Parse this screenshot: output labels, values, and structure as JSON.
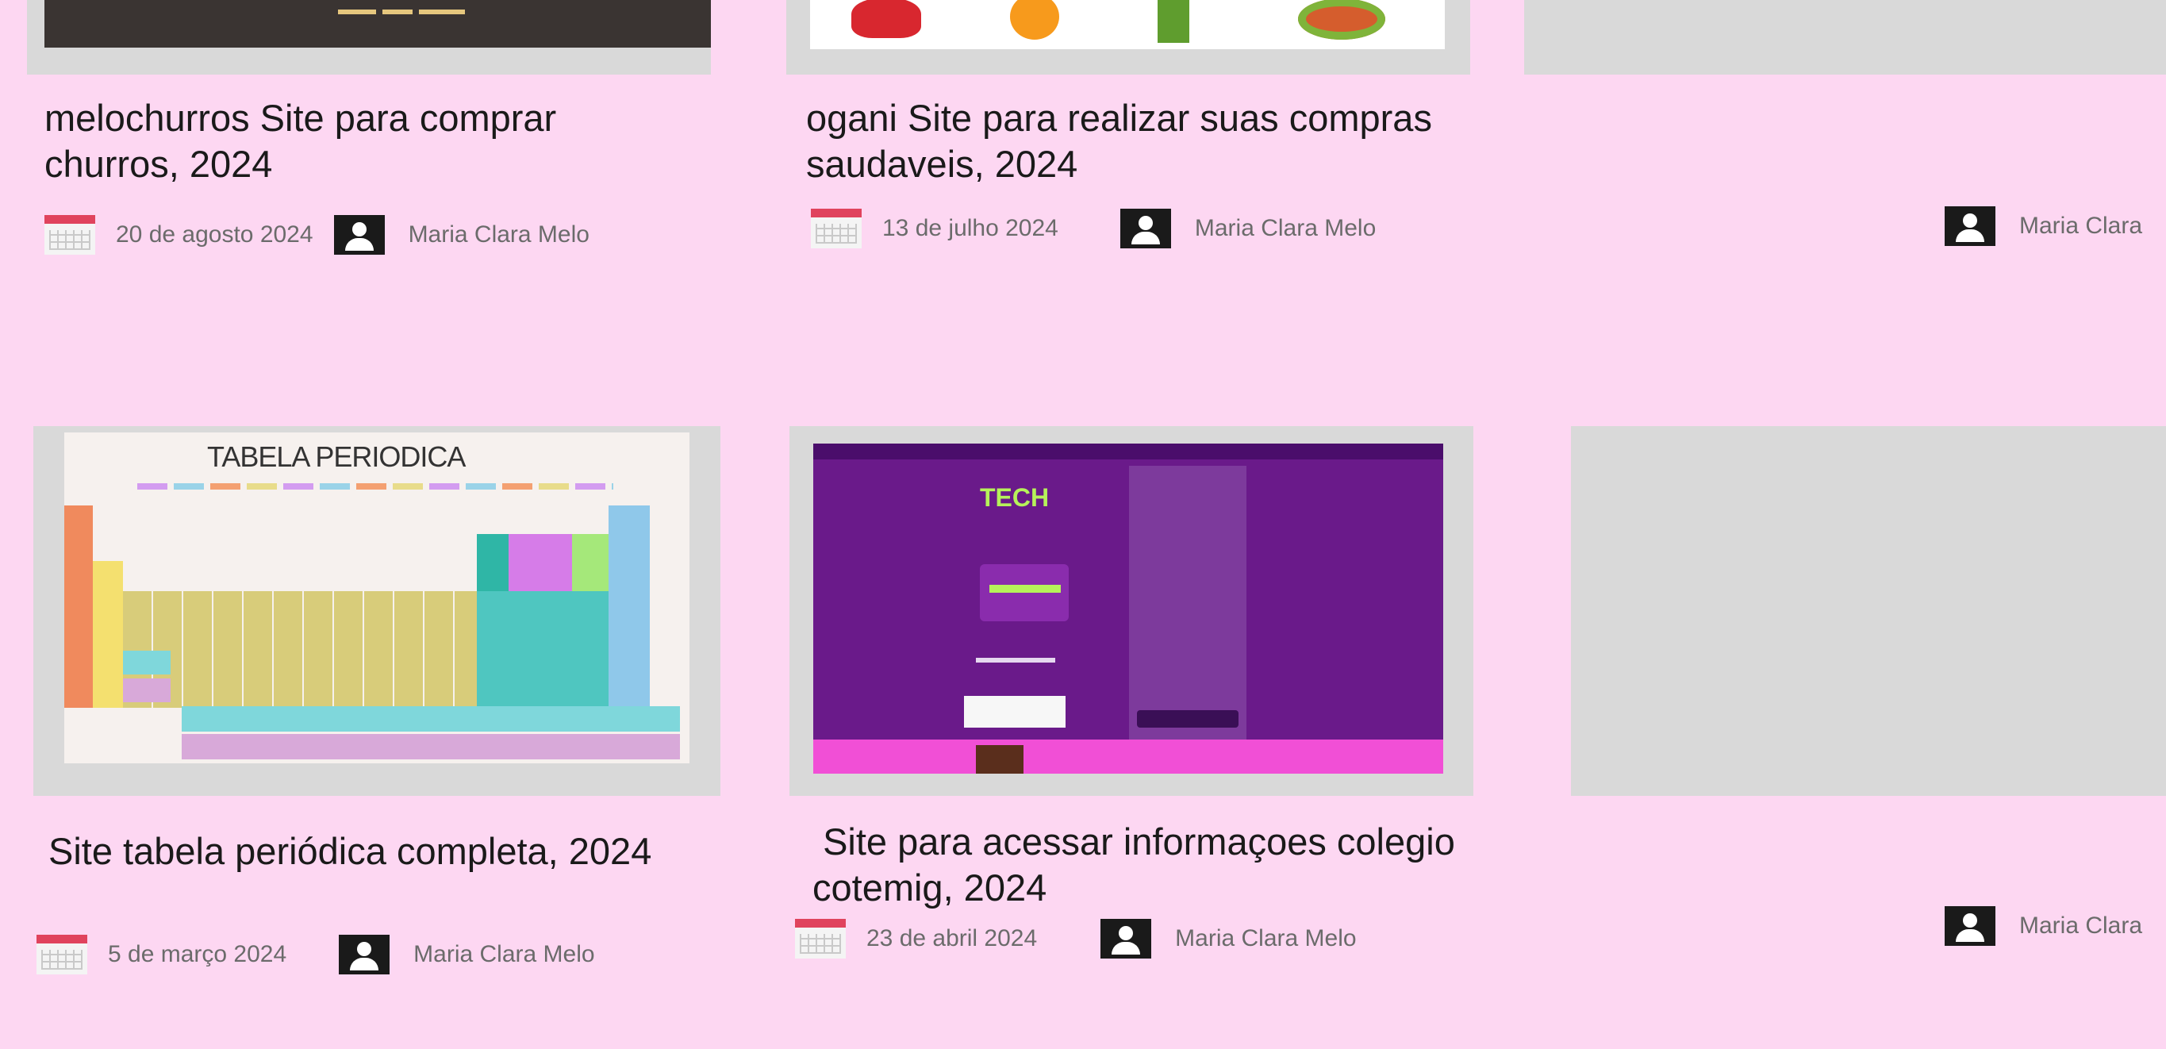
{
  "cards": [
    {
      "title": "melochurros Site para comprar churros, 2024",
      "date": "20 de agosto 2024",
      "author": "Maria Clara Melo"
    },
    {
      "title": "ogani Site para realizar suas compras saudaveis, 2024",
      "date": "13 de julho 2024",
      "author": "Maria Clara Melo"
    },
    {
      "title": "",
      "date": "",
      "author": "Maria Clara"
    },
    {
      "title": "Site tabela periódica completa, 2024",
      "date": "5 de março 2024",
      "author": "Maria Clara Melo",
      "thumbnail_heading": "TABELA PERIODICA"
    },
    {
      "title": " Site para acessar informaçoes colegio cotemig, 2024",
      "date": "23 de abril 2024",
      "author": "Maria Clara Melo",
      "thumbnail_heading": "TECH"
    },
    {
      "title": "",
      "date": "",
      "author": "Maria Clara"
    }
  ],
  "colors": {
    "background": "#fdd7f2",
    "placeholder": "#d9d9d9",
    "calendar_accent": "#e0435d",
    "cotemig_purple": "#6a1a8a",
    "cotemig_pink": "#f14fd6"
  },
  "icons": [
    "calendar-icon",
    "user-icon"
  ]
}
